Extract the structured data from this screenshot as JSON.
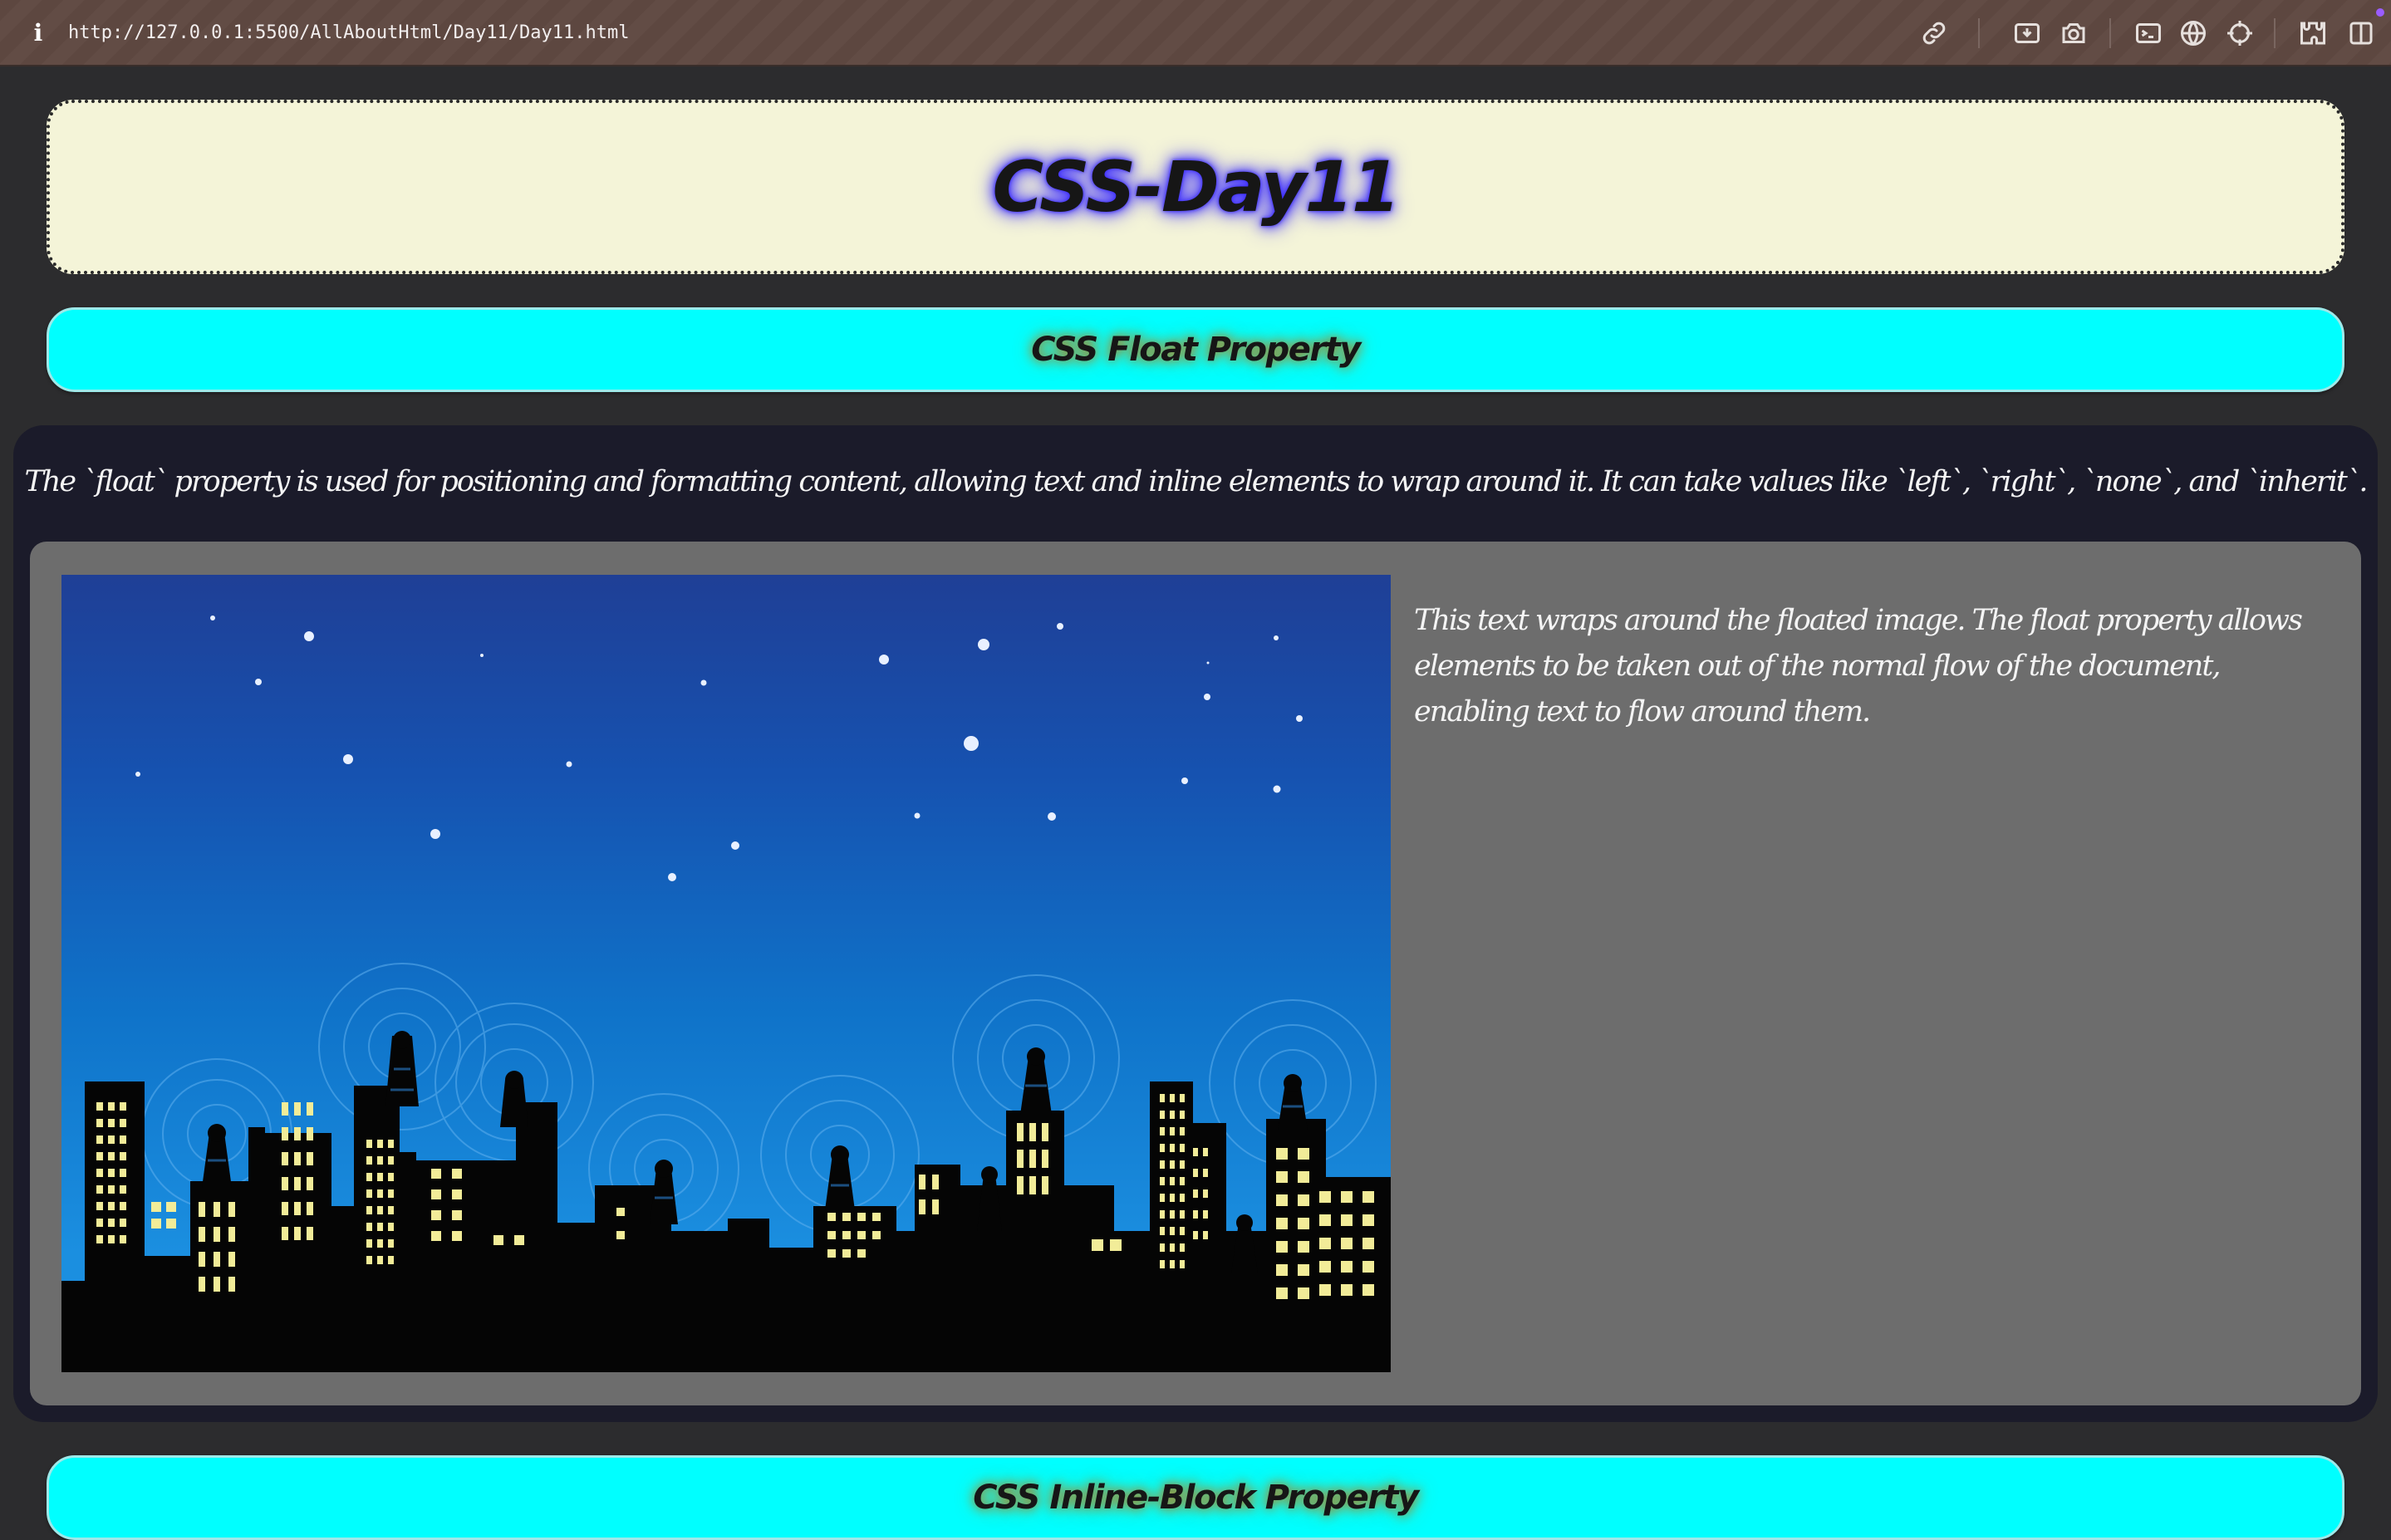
{
  "browser": {
    "url": "http://127.0.0.1:5500/AllAboutHtml/Day11/Day11.html",
    "info_icon_glyph": "i",
    "toolbar_icons": [
      "link-icon",
      "screenshot-region-icon",
      "camera-icon",
      "terminal-icon",
      "globe-icon",
      "crosshair-icon",
      "extensions-icon",
      "sidebar-icon"
    ]
  },
  "page": {
    "title": "CSS-Day11",
    "float_section": {
      "heading": "CSS Float Property",
      "description": "The `float` property is used for positioning and formatting content, allowing text and inline elements to wrap around it. It can take values like `left`, `right`, `none`, and `inherit`.",
      "wrap_text": "This text wraps around the floated image. The float property allows elements to be taken out of the normal flow of the document, enabling text to flow around them.",
      "image": "night city skyline with radio towers"
    },
    "next_section": {
      "heading": "CSS Inline-Block Property"
    }
  },
  "colors": {
    "page_bg": "#2c2c2e",
    "hero_bg": "#f4f4d8",
    "heading_bg": "#00ffff",
    "card_bg": "#1b1b2a",
    "box_bg": "#6d6d6d",
    "title_glow": "#3b2bff"
  }
}
